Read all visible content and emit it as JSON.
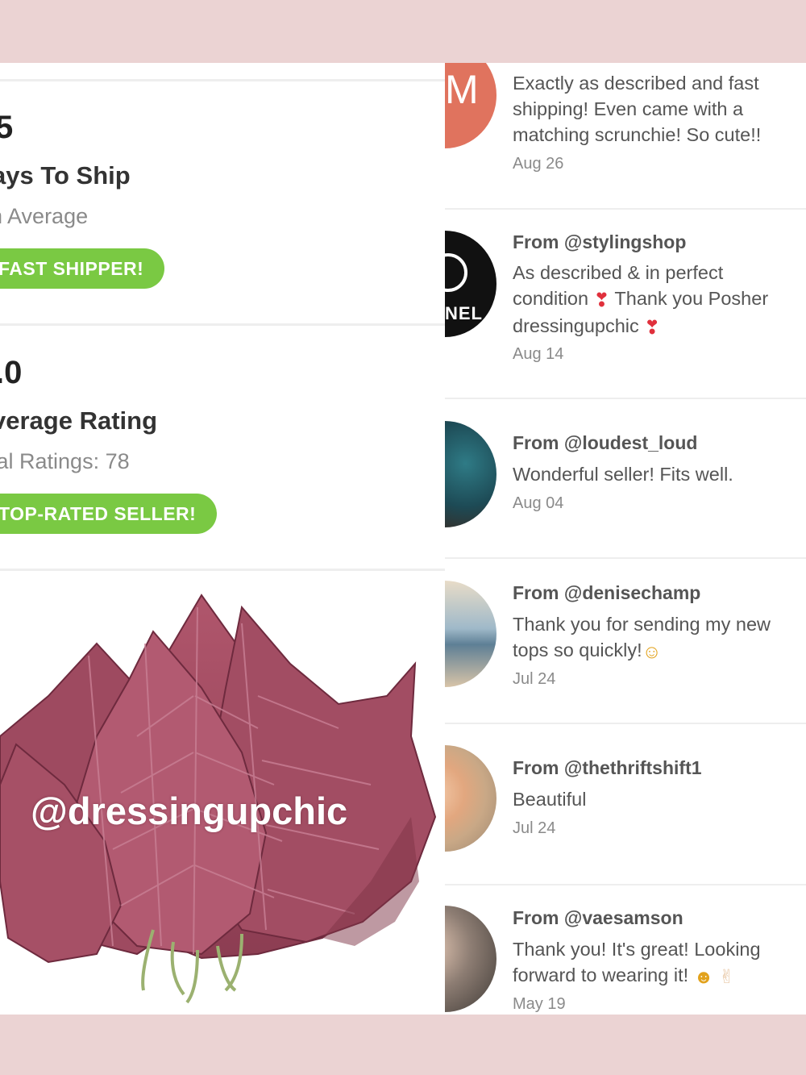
{
  "stats": {
    "ship": {
      "number": "5",
      "title": "ays To Ship",
      "subtitle": "n Average",
      "badge": "FAST SHIPPER!"
    },
    "rating": {
      "number": ".0",
      "title": "verage Rating",
      "subtitle": "tal Ratings: 78",
      "badge": "TOP-RATED SELLER!"
    }
  },
  "watermark": "@dressingupchic",
  "colors": {
    "frame": "#ebd3d3",
    "badge_green": "#7ac943",
    "leaf": "#9c4a5e"
  },
  "reviews": [
    {
      "avatar_letter": "M",
      "text": "Exactly as described and fast shipping! Even came with a matching scrunchie! So cute!!",
      "date": "Aug 26"
    },
    {
      "avatar_text": "NEL",
      "from": "From @stylingshop",
      "text_parts": [
        "As described & in perfect condition",
        "Thank you Posher dressingupchic"
      ],
      "date": "Aug 14"
    },
    {
      "from": "From @loudest_loud",
      "text": "Wonderful seller! Fits well.",
      "date": "Aug 04"
    },
    {
      "from": "From @denisechamp",
      "text": "Thank you for sending my new tops so quickly!",
      "date": "Jul 24"
    },
    {
      "from": "From @thethriftshift1",
      "text": "Beautiful",
      "date": "Jul 24"
    },
    {
      "from": "From @vaesamson",
      "text": "Thank you! It's great! Looking forward to wearing it!",
      "date": "May 19"
    }
  ]
}
